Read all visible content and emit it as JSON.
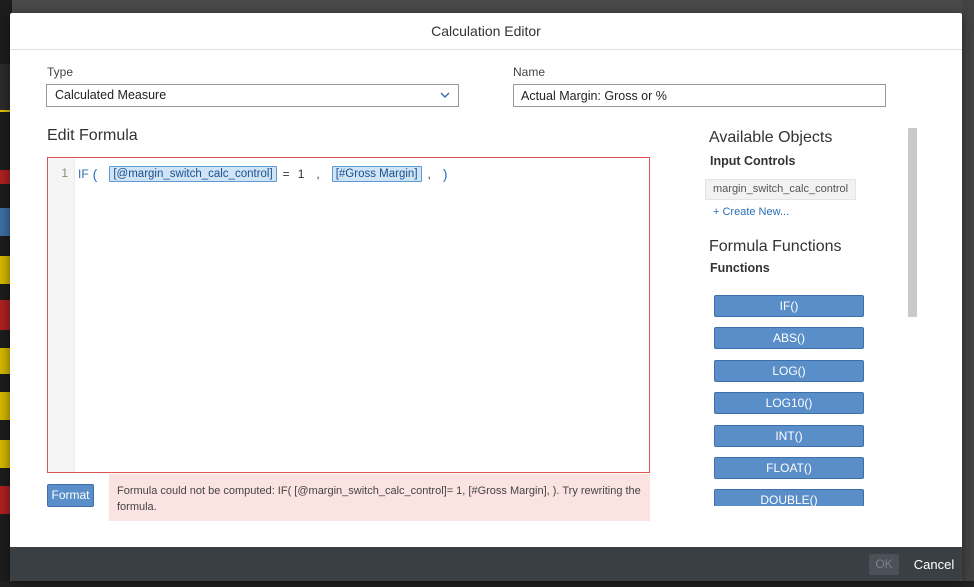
{
  "dialog": {
    "title": "Calculation Editor"
  },
  "type_field": {
    "label": "Type",
    "value": "Calculated Measure"
  },
  "name_field": {
    "label": "Name",
    "value": "Actual Margin: Gross or %"
  },
  "editor": {
    "title": "Edit Formula",
    "line_number": "1",
    "keyword": "IF",
    "open_paren": "(",
    "token_control": "[@margin_switch_calc_control]",
    "operator": "=",
    "number": "1",
    "comma1": ",",
    "token_measure": "[#Gross Margin]",
    "comma2": ",",
    "close_paren": ")",
    "border_color": "#d9534f"
  },
  "format_button": {
    "label": "Format"
  },
  "error": {
    "message": "Formula could not be computed: IF( [@margin_switch_calc_control]= 1, [#Gross Margin], ). Try rewriting the formula."
  },
  "available_objects": {
    "title": "Available Objects",
    "input_controls_title": "Input Controls",
    "input_controls": [
      "margin_switch_calc_control"
    ],
    "create_new": "+ Create New..."
  },
  "formula_functions": {
    "title": "Formula Functions",
    "functions_title": "Functions",
    "items": [
      "IF()",
      "ABS()",
      "LOG()",
      "LOG10()",
      "INT()",
      "FLOAT()",
      "DOUBLE()"
    ]
  },
  "footer": {
    "ok_label": "OK",
    "cancel_label": "Cancel"
  },
  "colors": {
    "accent": "#5a8ec8",
    "error_bg": "#fbe3e2",
    "footer_bg": "#3a3f44"
  }
}
